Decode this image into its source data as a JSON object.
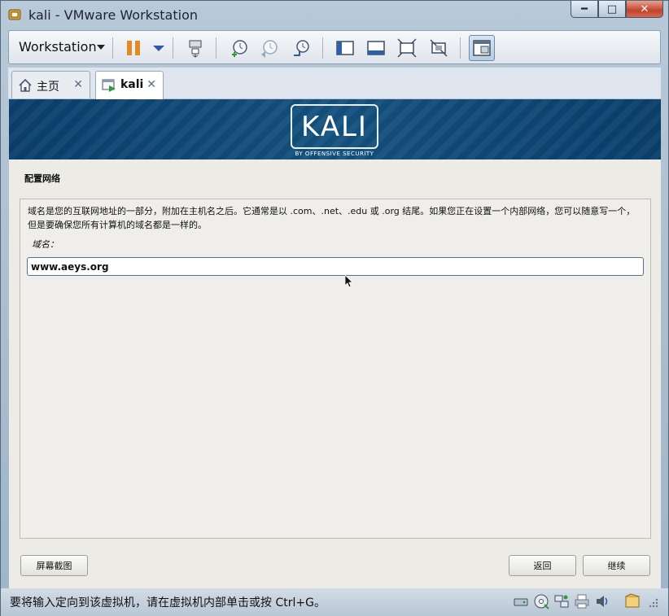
{
  "window": {
    "title": "kali - VMware Workstation",
    "minimize": "━",
    "maximize": "□",
    "close": "✕"
  },
  "toolbar": {
    "workstation_menu": "Workstation"
  },
  "tabs": [
    {
      "label": "主页",
      "close": "✕"
    },
    {
      "label": "kali",
      "close": "✕"
    }
  ],
  "vm": {
    "logo": "KALI",
    "logo_subtitle": "BY OFFENSIVE SECURITY",
    "section_title": "配置网络",
    "description": "域名是您的互联网地址的一部分，附加在主机名之后。它通常是以 .com、.net、.edu 或 .org 结尾。如果您正在设置一个内部网络，您可以随意写一个，但是要确保您所有计算机的域名都是一样的。",
    "field_label": "域名：",
    "domain_value": "www.aeys.org",
    "screenshot_button": "屏幕截图",
    "back_button": "返回",
    "continue_button": "继续"
  },
  "statusbar": {
    "message": "要将输入定向到该虚拟机，请在虚拟机内部单击或按 Ctrl+G。"
  },
  "colors": {
    "banner": "#14527f",
    "accent": "#1e73be",
    "pause": "#e08b25"
  }
}
